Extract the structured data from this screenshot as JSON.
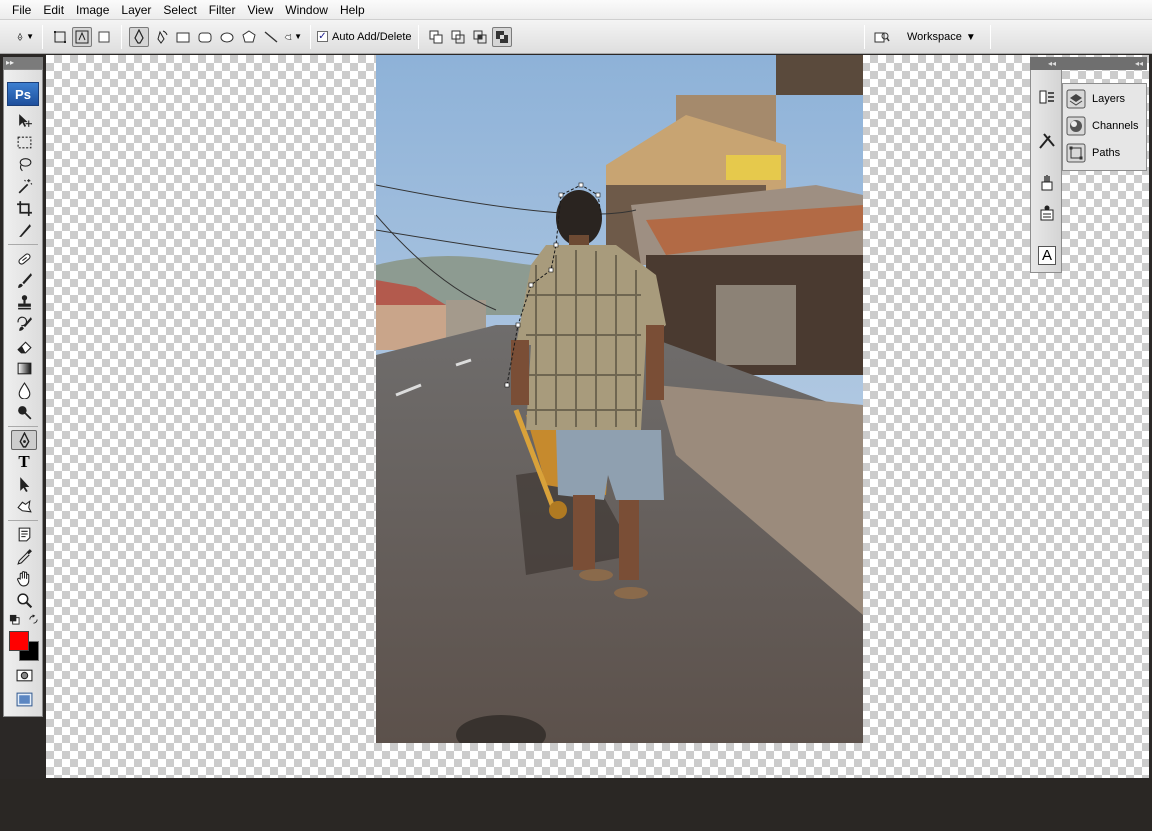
{
  "menu": [
    "File",
    "Edit",
    "Image",
    "Layer",
    "Select",
    "Filter",
    "View",
    "Window",
    "Help"
  ],
  "options": {
    "auto_add_delete_label": "Auto Add/Delete",
    "auto_add_delete_checked": true,
    "workspace_label": "Workspace"
  },
  "toolbox": {
    "logo": "Ps",
    "tools": [
      "move-icon",
      "marquee-icon",
      "lasso-icon",
      "magic-wand-icon",
      "crop-icon",
      "slice-icon",
      "healing-brush-icon",
      "brush-icon",
      "clone-stamp-icon",
      "history-brush-icon",
      "eraser-icon",
      "gradient-icon",
      "blur-icon",
      "dodge-icon",
      "pen-icon",
      "type-icon",
      "path-selection-icon",
      "custom-shape-icon",
      "notes-icon",
      "eyedropper-icon",
      "hand-icon",
      "zoom-icon"
    ],
    "selected_tool": "pen-icon",
    "type_tool_glyph": "T",
    "foreground_color": "#ff0000",
    "background_color": "#000000"
  },
  "panels": {
    "items": [
      "Layers",
      "Channels",
      "Paths"
    ],
    "character_icon_glyph": "A"
  }
}
